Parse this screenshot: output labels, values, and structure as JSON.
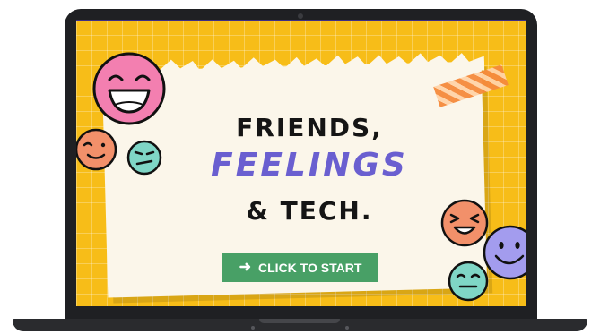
{
  "title": {
    "line1": "FRIENDS,",
    "line2": "FEELINGS",
    "line3": "& TECH."
  },
  "start_button": {
    "label": "CLICK TO START",
    "icon": "arrow-right-icon"
  },
  "colors": {
    "background": "#f7bd18",
    "paper": "#fbf6ea",
    "button": "#48a066",
    "accent_purple": "#6a5fd0",
    "face_pink": "#f37fb0",
    "face_orange": "#f2906a",
    "face_teal": "#7fd6c6",
    "face_lavender": "#a39cee"
  }
}
